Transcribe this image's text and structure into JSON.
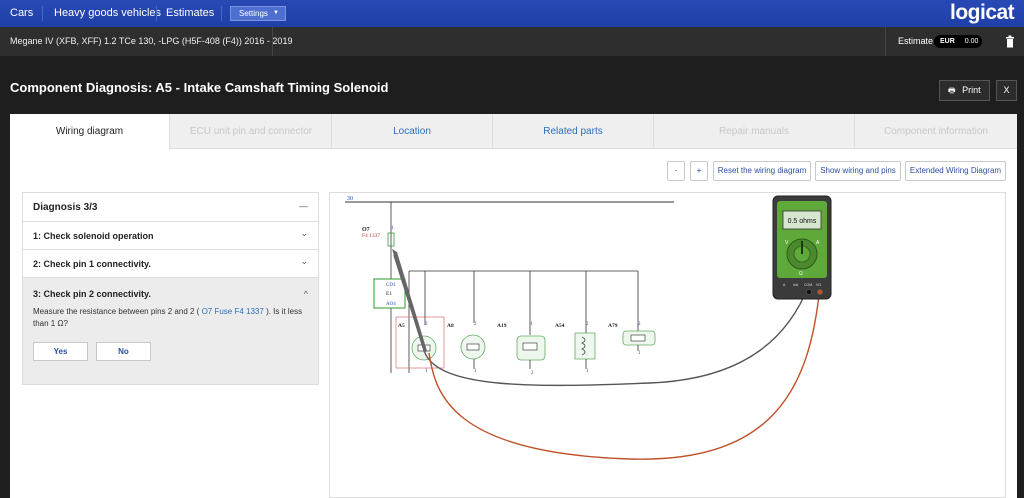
{
  "nav": {
    "items": [
      "Cars",
      "Heavy goods vehicles",
      "Estimates"
    ],
    "settings_label": "Settings",
    "logo": "logicat"
  },
  "vehicle_bar": {
    "vehicle": "Megane IV (XFB, XFF) 1.2 TCe 130, -LPG (H5F-408 (F4)) 2016 - 2019",
    "estimate_label": "Estimate",
    "currency": "EUR",
    "amount": "0.00"
  },
  "page": {
    "title": "Component Diagnosis: A5 - Intake Camshaft Timing Solenoid",
    "print_label": "Print",
    "close_label": "X"
  },
  "tabs": [
    {
      "label": "Wiring diagram",
      "state": "active"
    },
    {
      "label": "ECU unit pin and connector",
      "state": "disabled"
    },
    {
      "label": "Location",
      "state": "link"
    },
    {
      "label": "Related parts",
      "state": "link"
    },
    {
      "label": "Repair manuals",
      "state": "disabled"
    },
    {
      "label": "Component information",
      "state": "disabled"
    }
  ],
  "toolbar": {
    "zoom_out": "-",
    "zoom_in": "+",
    "reset": "Reset the wiring diagram",
    "show": "Show wiring and pins",
    "extended": "Extended Wiring Diagram"
  },
  "diagnosis": {
    "title": "Diagnosis 3/3",
    "collapse": "—",
    "steps": [
      {
        "label": "1: Check solenoid operation",
        "chevron": "⌄"
      },
      {
        "label": "2: Check pin 1 connectivity.",
        "chevron": "⌄"
      },
      {
        "label": "3: Check pin 2 connectivity.",
        "chevron": "^"
      }
    ],
    "message_pre": "Measure the resistance between pins 2 and 2 (",
    "message_link": "O7 Fuse F4 1337",
    "message_post": "). Is it less than 1 Ω?",
    "yes": "Yes",
    "no": "No"
  },
  "diagram": {
    "bus_label": "30",
    "fuse_name": "O7",
    "fuse_code": "F4 1337",
    "fuse_pin": "1",
    "ecu_top": "CD1",
    "ecu_mid": "E1",
    "ecu_bottom": "AO4",
    "components": [
      {
        "name": "A5",
        "pin_top": "2",
        "pin_bottom": "1"
      },
      {
        "name": "A8",
        "pin_top": "2",
        "pin_bottom": "1"
      },
      {
        "name": "A19",
        "pin_top": "1",
        "pin_bottom": "2"
      },
      {
        "name": "A54",
        "pin_top": "2",
        "pin_bottom": "1"
      },
      {
        "name": "A79",
        "pin_top": "2",
        "pin_bottom": "1"
      }
    ],
    "meter_reading": "0.5 ohms",
    "meter_left": "V",
    "meter_right": "A",
    "meter_bottom": "Ω",
    "meter_ports": [
      "A",
      "mA",
      "COM",
      "VΩ"
    ],
    "probe_colors": {
      "black": "#555555",
      "red": "#c0522a"
    }
  }
}
